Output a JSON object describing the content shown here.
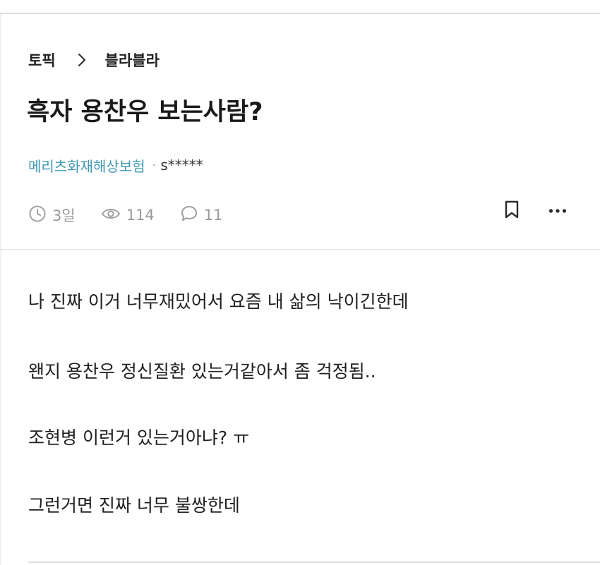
{
  "breadcrumb": {
    "topic": "토픽",
    "board": "블라블라"
  },
  "post": {
    "title": "흑자 용찬우 보는사람?",
    "company": "메리츠화재해상보험",
    "separator": "·",
    "username": "s*****",
    "time_ago": "3일",
    "views": "114",
    "comments": "11",
    "body": [
      "나 진짜 이거 너무재밌어서 요즘 내 삶의 낙이긴한데",
      "왠지 용찬우 정신질환 있는거같아서 좀 걱정됨..",
      "조현병 이런거 있는거아냐? ㅠ",
      "그런거면 진짜 너무 불쌍한데"
    ]
  },
  "icons": {
    "breadcrumb_separator": "chevron-right-icon",
    "time": "clock-icon",
    "views": "eye-icon",
    "comments": "comment-bubble-icon",
    "bookmark": "bookmark-icon",
    "more": "more-dots-icon"
  },
  "colors": {
    "company_accent": "#3f98b3",
    "meta_gray": "#9a9a9a",
    "text": "#1f1f1f"
  }
}
